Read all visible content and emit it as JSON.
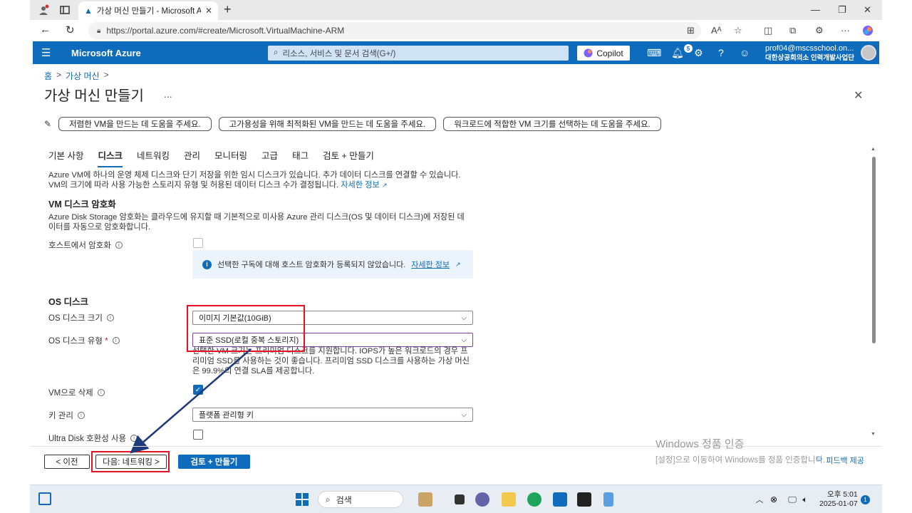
{
  "browser": {
    "tab_title": "가상 머신 만들기 - Microsoft Azure",
    "url": "https://portal.azure.com/#create/Microsoft.VirtualMachine-ARM",
    "new_tab": "+",
    "tab_close": "✕"
  },
  "azure_header": {
    "brand": "Microsoft Azure",
    "search_placeholder": "리소스, 서비스 및 문서 검색(G+/)",
    "copilot": "Copilot",
    "notification_count": "5",
    "account_email": "prof04@mscsschool.on...",
    "account_org": "대한상공회의소 인력개발사업단"
  },
  "breadcrumb": {
    "home": "홈",
    "sep1": ">",
    "vm": "가상 머신",
    "sep2": ">"
  },
  "page": {
    "title": "가상 머신 만들기",
    "more": "...",
    "help_buttons": [
      "저렴한 VM을 만드는 데 도움을 주세요.",
      "고가용성을 위해 최적화된 VM을 만드는 데 도움을 주세요.",
      "워크로드에 적합한 VM 크기를 선택하는 데 도움을 주세요."
    ],
    "tabs": [
      "기본 사항",
      "디스크",
      "네트워킹",
      "관리",
      "모니터링",
      "고급",
      "태그",
      "검토 + 만들기"
    ],
    "intro_line1": "Azure VM에 하나의 운영 체제 디스크와 단기 저장을 위한 임시 디스크가 있습니다. 추가 데이터 디스크를 연결할 수 있습니다.",
    "intro_line2": "VM의 크기에 따라 사용 가능한 스토리지 유형 및 허용된 데이터 디스크 수가 결정됩니다.",
    "learn_more": "자세한 정보",
    "enc_heading": "VM 디스크 암호화",
    "enc_line1": "Azure Disk Storage 암호화는 클라우드에 유지할 때 기본적으로 미사용 Azure 관리 디스크(OS 및 데이터 디스크)에 저장된 데",
    "enc_line2": "이터를 자동으로 암호화합니다.",
    "host_enc_label": "호스트에서 암호화",
    "host_enc_info": "선택한 구독에 대해 호스트 암호화가 등록되지 않았습니다.",
    "host_enc_link": "자세한 정보",
    "os_heading": "OS 디스크",
    "os_size_label": "OS 디스크 크기",
    "os_size_value": "이미지 기본값(10GiB)",
    "os_type_label": "OS 디스크 유형",
    "required_mark": "*",
    "os_type_value": "표준 SSD(로컬 중복 스토리지)",
    "os_type_note1": "선택한 VM 크기는 프리미엄 디스크를 지원합니다. IOPS가 높은 워크로드의 경우 프",
    "os_type_note2": "리미엄 SSD를 사용하는 것이 좋습니다. 프리미엄 SSD 디스크를 사용하는 가상 머신",
    "os_type_note3": "은 99.9%의 연결 SLA를 제공합니다.",
    "delete_label": "VM으로 삭제",
    "key_label": "키 관리",
    "key_value": "플랫폼 관리형 키",
    "ultra_label": "Ultra Disk 호환성 사용"
  },
  "footer": {
    "prev": "< 이전",
    "next": "다음: 네트워킹 >",
    "review": "검토 + 만들기",
    "feedback": "피드백 제공"
  },
  "watermark": {
    "line1": "Windows 정품 인증",
    "line2": "[설정]으로 이동하여 Windows를 정품 인증합니다."
  },
  "taskbar": {
    "search": "검색",
    "time": "오후 5:01",
    "date": "2025-01-07",
    "notif": "1"
  },
  "colors": {
    "azure_blue": "#0f6cbd",
    "highlight_red": "#e81123",
    "arrow": "#1f3a7a"
  }
}
